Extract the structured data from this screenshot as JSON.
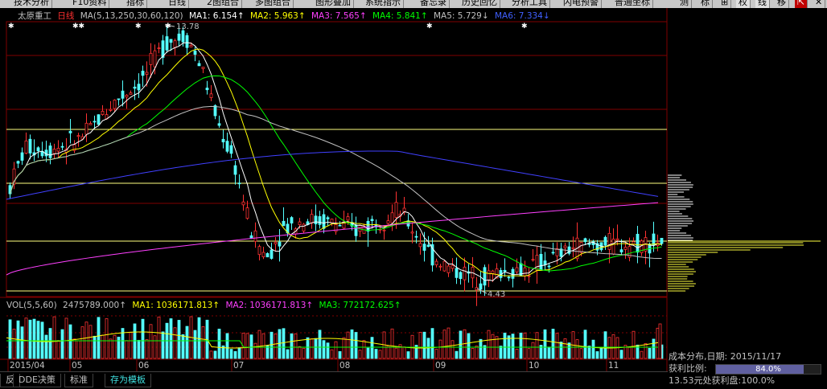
{
  "toolbar": [
    {
      "label": "技术分析",
      "x": 14
    },
    {
      "label": "F10资料",
      "x": 87
    },
    {
      "label": "指标",
      "x": 154
    },
    {
      "label": "日线",
      "x": 206
    },
    {
      "label": "2图组合",
      "x": 254
    },
    {
      "label": "多图组合",
      "x": 314
    },
    {
      "label": "图形叠加",
      "x": 389
    },
    {
      "label": "系统指示",
      "x": 451
    },
    {
      "label": "备忘录",
      "x": 519
    },
    {
      "label": "历史回忆",
      "x": 571
    },
    {
      "label": "分析工具",
      "x": 633
    },
    {
      "label": "闪电预警",
      "x": 697
    },
    {
      "label": "普通坐标",
      "x": 761
    },
    {
      "label": "测",
      "x": 842
    },
    {
      "label": "标",
      "x": 868
    },
    {
      "label": "⊞",
      "x": 893
    },
    {
      "label": "权",
      "x": 915,
      "active": true
    },
    {
      "label": "线",
      "x": 939,
      "active": true
    },
    {
      "label": "移",
      "x": 963
    },
    {
      "label": "⇱",
      "x": 988,
      "red": true
    },
    {
      "label": "✕",
      "x": 1010
    }
  ],
  "info": {
    "stock": "太原重工",
    "period": "日线",
    "ma_label": "MA(5,13,250,30,60,120)",
    "ma1": "MA1: 6.154↑",
    "ma2": "MA2: 5.963↑",
    "ma3": "MA3: 7.565↑",
    "ma4": "MA4: 5.841↑",
    "ma5": "MA5: 5.729↓",
    "ma6": "MA6: 7.334↓"
  },
  "volinfo": {
    "label": "VOL(5,5,60)",
    "vol": "2475789.000↑",
    "ma1": "MA1: 1036171.813↑",
    "ma2": "MA2: 1036171.813↑",
    "ma3": "MA3: 772172.625↑"
  },
  "markers": {
    "high": "13.78",
    "low": "4.43",
    "stars": [
      "✱",
      "✱✱",
      "✱",
      "✱",
      "✱",
      "✱"
    ]
  },
  "x_labels": [
    "2015/04",
    "05",
    "06",
    "07",
    "08",
    "09",
    "10",
    "11"
  ],
  "bottom_tabs": [
    {
      "label": "反"
    },
    {
      "label": "DDE决策"
    },
    {
      "label": "标准"
    },
    {
      "label": "存为模板",
      "active": true
    }
  ],
  "cost": {
    "title": "成本分布,日期: 2015/11/17",
    "ratio_label": "获利比例:",
    "ratio_value": "84.0%",
    "ratio": 0.84,
    "note": "13.53元处获利盘:100.0%"
  },
  "colors": {
    "up": "#ff3232",
    "down": "#54ffff",
    "ma1": "#ffffff",
    "ma2": "#ffff00",
    "ma3": "#ff40ff",
    "ma4": "#00ff00",
    "ma5": "#c0c0c0",
    "ma6": "#4040ff",
    "grid": "#800000",
    "hline": "#ffff80"
  },
  "chart_data": {
    "type": "candlestick",
    "title": "太原重工 日线",
    "x_axis": [
      "2015/04",
      "05",
      "06",
      "07",
      "08",
      "09",
      "10",
      "11"
    ],
    "price_range": [
      4.43,
      13.78
    ],
    "high": 13.78,
    "low": 4.43,
    "series": [
      {
        "name": "MA1",
        "values": [
          6.154
        ]
      },
      {
        "name": "MA2",
        "values": [
          5.963
        ]
      },
      {
        "name": "MA3",
        "values": [
          7.565
        ]
      },
      {
        "name": "MA4",
        "values": [
          5.841
        ]
      },
      {
        "name": "MA5",
        "values": [
          5.729
        ]
      },
      {
        "name": "MA6",
        "values": [
          7.334
        ]
      }
    ],
    "volume": {
      "last": 2475789.0,
      "ma1": 1036171.813,
      "ma2": 1036171.813,
      "ma3": 772172.625
    }
  }
}
